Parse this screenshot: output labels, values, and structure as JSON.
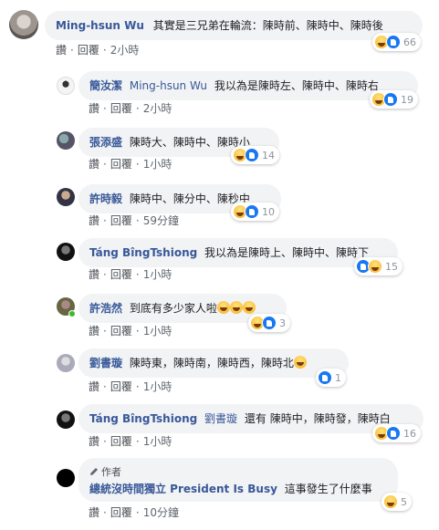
{
  "main": {
    "author": "Ming-hsun Wu",
    "text": "其實是三兄弟在輪流：陳時前、陳時中、陳時後",
    "like_label": "讚",
    "reply_label": "回覆",
    "time": "2小時",
    "react_count": "66"
  },
  "replies": [
    {
      "author": "簡汝潔",
      "tag": "Ming-hsun Wu",
      "text": "我以為是陳時左、陳時中、陳時右",
      "like_label": "讚",
      "reply_label": "回覆",
      "time": "2小時",
      "react_count": "19"
    },
    {
      "author": "張添盛",
      "text": "陳時大、陳時中、陳時小",
      "like_label": "讚",
      "reply_label": "回覆",
      "time": "1小時",
      "react_count": "14"
    },
    {
      "author": "許時毅",
      "text": "陳時中、陳分中、陳秒中",
      "like_label": "讚",
      "reply_label": "回覆",
      "time": "59分鐘",
      "react_count": "10"
    },
    {
      "author": "Táng BîngTshiong",
      "text": "我以為是陳時上、陳時中、陳時下",
      "like_label": "讚",
      "reply_label": "回覆",
      "time": "1小時",
      "react_count": "15"
    },
    {
      "author": "許浩然",
      "text": "到底有多少家人啦",
      "like_label": "讚",
      "reply_label": "回覆",
      "time": "1小時",
      "react_count": "3"
    },
    {
      "author": "劉書璇",
      "text": "陳時東，陳時南，陳時西，陳時北",
      "like_label": "讚",
      "reply_label": "回覆",
      "time": "1小時",
      "react_count": "1"
    },
    {
      "author": "Táng BîngTshiong",
      "tag": "劉書璇",
      "text": "還有 陳時中，陳時發，陳時白",
      "like_label": "讚",
      "reply_label": "回覆",
      "time": "1小時",
      "react_count": "16"
    },
    {
      "badge": "作者",
      "author": "總統沒時間獨立 President Is Busy",
      "text": "這事發生了什麼事",
      "like_label": "讚",
      "reply_label": "回覆",
      "time": "10分鐘",
      "react_count": "5"
    }
  ],
  "icons": {
    "haha": "haha-reaction-icon",
    "like": "like-reaction-icon"
  }
}
